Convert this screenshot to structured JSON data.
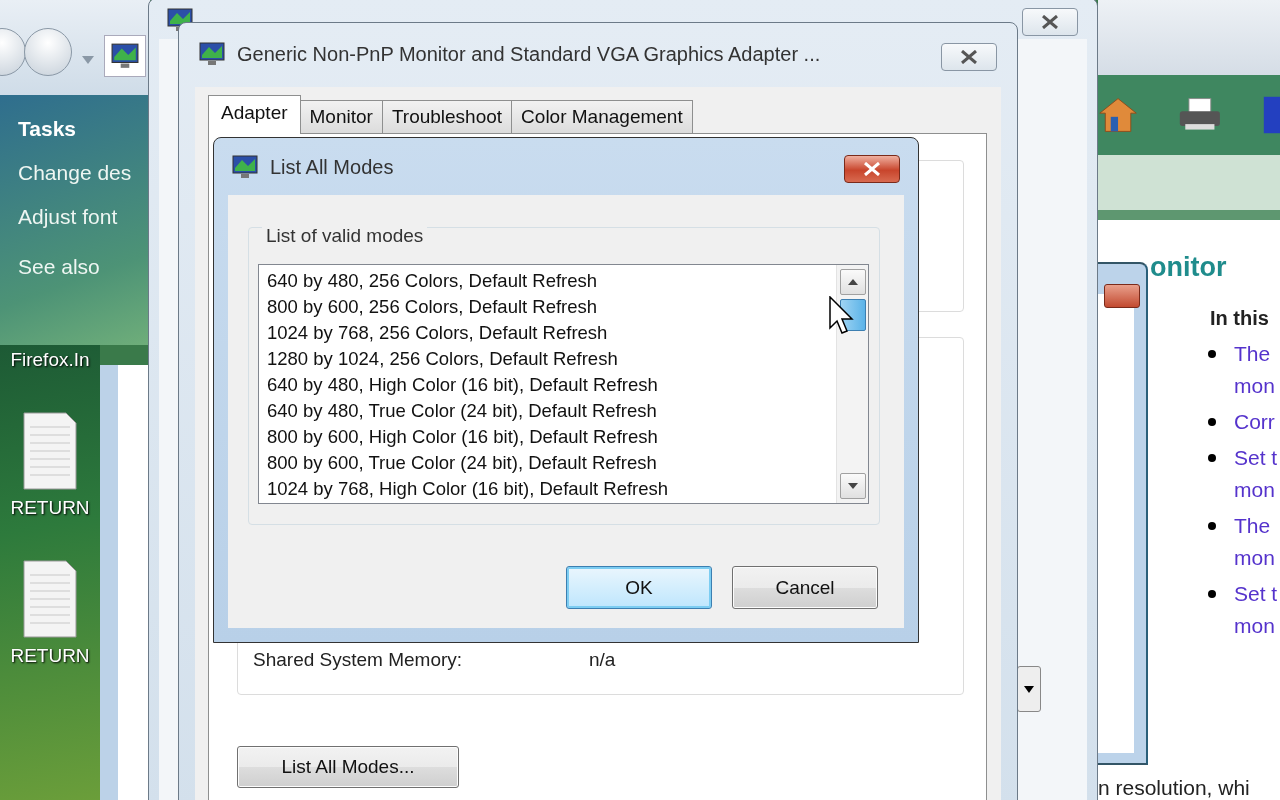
{
  "explorer": {
    "heading": "Tasks",
    "links": [
      "Change des",
      "Adjust font"
    ],
    "see_also": "See also"
  },
  "desktop_icons": [
    {
      "label": "Firefox.In",
      "kind": "label"
    },
    {
      "label": "RETURN",
      "kind": "document"
    },
    {
      "label": "RETURN",
      "kind": "document"
    }
  ],
  "help": {
    "heading": "onitor",
    "subheading": "In this",
    "links": [
      {
        "lines": [
          "The",
          "mon"
        ]
      },
      {
        "lines": [
          "Corr"
        ]
      },
      {
        "lines": [
          "Set t",
          "mon"
        ]
      },
      {
        "lines": [
          "The",
          "mon"
        ]
      },
      {
        "lines": [
          "Set t",
          "mon"
        ]
      }
    ],
    "footer": "n resolution, whi"
  },
  "dialog": {
    "title": "Generic Non-PnP Monitor and Standard VGA Graphics Adapter ...",
    "tabs": [
      {
        "label": "Adapter",
        "selected": true
      },
      {
        "label": "Monitor",
        "selected": false
      },
      {
        "label": "Troubleshoot",
        "selected": false
      },
      {
        "label": "Color Management",
        "selected": false
      }
    ],
    "memory_label": "Shared System Memory:",
    "memory_value": "n/a",
    "list_button": "List All Modes..."
  },
  "modal": {
    "title": "List All Modes",
    "group": "List of valid modes",
    "modes": [
      {
        "label": "640 by 480, 256 Colors, Default Refresh",
        "selected": false
      },
      {
        "label": "800 by 600, 256 Colors, Default Refresh",
        "selected": false
      },
      {
        "label": "1024 by 768, 256 Colors, Default Refresh",
        "selected": false
      },
      {
        "label": "1280 by 1024, 256 Colors, Default Refresh",
        "selected": false
      },
      {
        "label": "640 by 480, High Color (16 bit), Default Refresh",
        "selected": false
      },
      {
        "label": "640 by 480, True Color (24 bit), Default Refresh",
        "selected": false
      },
      {
        "label": "800 by 600, High Color (16 bit), Default Refresh",
        "selected": false
      },
      {
        "label": "800 by 600, True Color (24 bit), Default Refresh",
        "selected": false
      },
      {
        "label": "1024 by 768, High Color (16 bit), Default Refresh",
        "selected": false
      }
    ],
    "buttons": [
      {
        "label": "OK",
        "default": true
      },
      {
        "label": "Cancel",
        "default": false
      }
    ]
  }
}
